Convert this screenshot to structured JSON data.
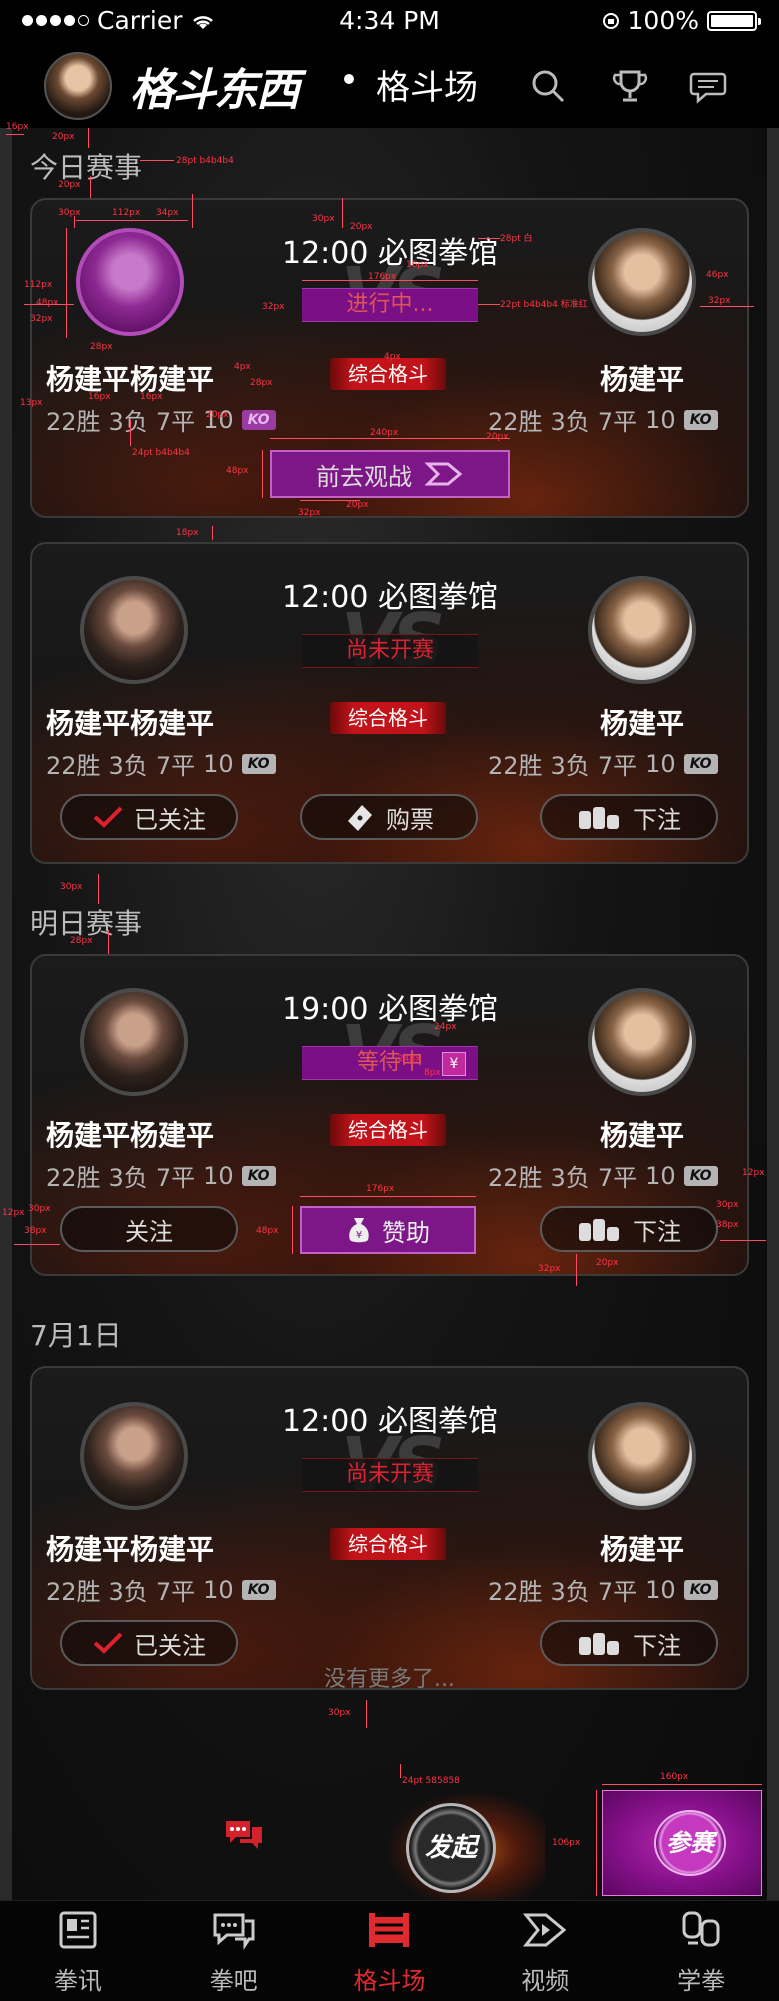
{
  "status_bar": {
    "carrier": "Carrier",
    "time": "4:34 PM",
    "battery": "100%"
  },
  "navbar": {
    "logo": "格斗东西",
    "title": "格斗场"
  },
  "sections": [
    {
      "title": "今日赛事"
    },
    {
      "title": "明日赛事"
    },
    {
      "title": "7月1日"
    }
  ],
  "cards": [
    {
      "time_venue": "12:00  必图拳馆",
      "vs": "VS",
      "status": "进行中...",
      "category": "综合格斗",
      "left": {
        "name": "杨建平杨建平",
        "wins": "22胜",
        "losses": "3负",
        "draws": "7平",
        "ko": "10",
        "ko_label": "KO"
      },
      "right": {
        "name": "杨建平",
        "wins": "22胜",
        "losses": "3负",
        "draws": "7平",
        "ko": "10",
        "ko_label": "KO"
      },
      "watch_label": "前去观战"
    },
    {
      "time_venue": "12:00  必图拳馆",
      "vs": "VS",
      "status": "尚未开赛",
      "category": "综合格斗",
      "left": {
        "name": "杨建平杨建平",
        "wins": "22胜",
        "losses": "3负",
        "draws": "7平",
        "ko": "10",
        "ko_label": "KO"
      },
      "right": {
        "name": "杨建平",
        "wins": "22胜",
        "losses": "3负",
        "draws": "7平",
        "ko": "10",
        "ko_label": "KO"
      },
      "buttons": {
        "follow": "已关注",
        "ticket": "购票",
        "bet": "下注"
      }
    },
    {
      "time_venue": "19:00  必图拳馆",
      "vs": "VS",
      "status": "等待中",
      "category": "综合格斗",
      "left": {
        "name": "杨建平杨建平",
        "wins": "22胜",
        "losses": "3负",
        "draws": "7平",
        "ko": "10",
        "ko_label": "KO"
      },
      "right": {
        "name": "杨建平",
        "wins": "22胜",
        "losses": "3负",
        "draws": "7平",
        "ko": "10",
        "ko_label": "KO"
      },
      "buttons": {
        "follow": "关注",
        "sponsor": "赞助",
        "bet": "下注"
      }
    },
    {
      "time_venue": "12:00  必图拳馆",
      "vs": "VS",
      "status": "尚未开赛",
      "category": "综合格斗",
      "left": {
        "name": "杨建平杨建平",
        "wins": "22胜",
        "losses": "3负",
        "draws": "7平",
        "ko": "10",
        "ko_label": "KO"
      },
      "right": {
        "name": "杨建平",
        "wins": "22胜",
        "losses": "3负",
        "draws": "7平",
        "ko": "10",
        "ko_label": "KO"
      },
      "buttons": {
        "follow": "已关注",
        "bet": "下注"
      }
    }
  ],
  "no_more": "没有更多了...",
  "floating": {
    "launch": "发起",
    "join": "参赛"
  },
  "tabs": [
    {
      "label": "拳讯"
    },
    {
      "label": "拳吧"
    },
    {
      "label": "格斗场"
    },
    {
      "label": "视频"
    },
    {
      "label": "学拳"
    }
  ],
  "annotations": {
    "a16px": "16px",
    "a20px": "20px",
    "a28pt": "28pt b4b4b4",
    "a20px_2": "20px",
    "a30px": "30px",
    "a112px": "112px",
    "a34px": "34px",
    "a112px_2": "112px",
    "a48px": "48px",
    "a32px": "32px",
    "a28px": "28px",
    "a13px": "13px",
    "a16px_2": "16px",
    "a16px_3": "16px",
    "a20px_3": "20px",
    "a24pt": "24pt b4b4b4",
    "a4px": "4px",
    "a28px_2": "28px",
    "a48px_2": "48px",
    "a32px_2": "32px",
    "a20px_4": "20px",
    "a240px": "240px",
    "a20px_5": "20px",
    "a18px": "18px",
    "a20px_vs": "20px",
    "a30px_2": "30px",
    "a20px_6": "20px",
    "a16px_4": "16px",
    "a176px": "176px",
    "a32px_3": "32px",
    "a28pt_white": "28pt 白",
    "a22pt": "22pt b4b4b4  标准红",
    "a4px_2": "4px",
    "a46px": "46px",
    "a32px_4": "32px",
    "a30px_3": "30px",
    "a28px_3": "28px",
    "a24px": "24px",
    "a24px_2": "24px",
    "a8px": "8px",
    "a176px_2": "176px",
    "a48px_3": "48px",
    "a12px": "12px",
    "a30px_4": "30px",
    "a38px": "38px",
    "a12px_2": "12px",
    "a30px_5": "30px",
    "a38px_2": "38px",
    "a32px_5": "32px",
    "a20px_7": "20px",
    "a30px_6": "30px",
    "a24pt_2": "24pt 585858",
    "a160px": "160px",
    "a106px": "106px"
  }
}
